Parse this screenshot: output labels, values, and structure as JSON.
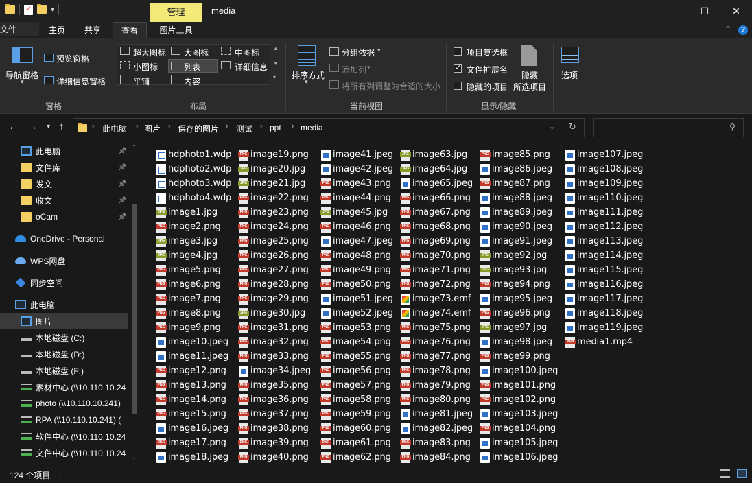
{
  "titlebar": {
    "contextual_tab": "管理",
    "title": "media",
    "minimize": "—",
    "maximize": "☐",
    "close": "✕"
  },
  "tabs": {
    "file": "文件",
    "home": "主页",
    "share": "共享",
    "view": "查看",
    "picture_tools": "图片工具"
  },
  "ribbon": {
    "panes": {
      "nav_pane": "导航窗格",
      "preview_pane": "预览窗格",
      "details_pane": "详细信息窗格",
      "group_label": "窗格"
    },
    "layout": {
      "extra_large": "超大图标",
      "large": "大图标",
      "medium": "中图标",
      "small": "小图标",
      "list": "列表",
      "details": "详细信息",
      "tiles": "平铺",
      "content": "内容",
      "group_label": "布局"
    },
    "current_view": {
      "sort_by": "排序方式",
      "group_by": "分组依据",
      "add_columns": "添加列",
      "size_all_columns": "将所有列调整为合适的大小",
      "group_label": "当前视图"
    },
    "show_hide": {
      "item_checkboxes": "项目复选框",
      "file_extensions": "文件扩展名",
      "hidden_items": "隐藏的项目",
      "hide_selected_1": "隐藏",
      "hide_selected_2": "所选项目",
      "group_label": "显示/隐藏",
      "item_checkboxes_checked": false,
      "file_extensions_checked": true,
      "hidden_items_checked": false
    },
    "options": "选项"
  },
  "address": {
    "breadcrumbs": [
      "此电脑",
      "图片",
      "保存的图片",
      "测试",
      "ppt",
      "media"
    ]
  },
  "nav": [
    {
      "label": "此电脑",
      "icon": "pc-icon",
      "pinned": true
    },
    {
      "label": "文件库",
      "icon": "folder-icon",
      "pinned": true
    },
    {
      "label": "发文",
      "icon": "folder-icon",
      "pinned": true
    },
    {
      "label": "收文",
      "icon": "folder-icon",
      "pinned": true
    },
    {
      "label": "oCam",
      "icon": "folder-icon",
      "pinned": true
    },
    {
      "label": "OneDrive - Personal",
      "icon": "onedrive-icon",
      "pinned": false
    },
    {
      "label": "WPS网盘",
      "icon": "wps-cloud-icon",
      "pinned": false
    },
    {
      "label": "同步空间",
      "icon": "sync-icon",
      "pinned": false
    },
    {
      "label": "此电脑",
      "icon": "pc-icon",
      "pinned": false
    },
    {
      "label": "图片",
      "icon": "pictures-icon",
      "pinned": false
    },
    {
      "label": "本地磁盘 (C:)",
      "icon": "drive-icon",
      "pinned": false
    },
    {
      "label": "本地磁盘 (D:)",
      "icon": "drive-icon",
      "pinned": false
    },
    {
      "label": "本地磁盘 (F:)",
      "icon": "drive-icon",
      "pinned": false
    },
    {
      "label": "素材中心 (\\\\10.110.10.24",
      "icon": "network-drive-icon",
      "pinned": false
    },
    {
      "label": "photo (\\\\10.110.10.241)",
      "icon": "network-drive-icon",
      "pinned": false
    },
    {
      "label": "RPA (\\\\10.110.10.241) (",
      "icon": "network-drive-icon",
      "pinned": false
    },
    {
      "label": "软件中心 (\\\\10.110.10.24",
      "icon": "network-drive-icon",
      "pinned": false
    },
    {
      "label": "文件中心 (\\\\10.110.10.24",
      "icon": "network-drive-icon",
      "pinned": false
    }
  ],
  "files": [
    [
      "hdphoto1.wdp",
      "hdphoto2.wdp",
      "hdphoto3.wdp",
      "hdphoto4.wdp",
      "image1.jpg",
      "image2.png",
      "image3.jpg",
      "image4.jpg",
      "image5.png",
      "image6.png",
      "image7.png",
      "image8.png",
      "image9.png",
      "image10.jpeg",
      "image11.jpeg",
      "image12.png",
      "image13.png",
      "image14.png",
      "image15.png",
      "image16.jpeg",
      "image17.png",
      "image18.jpeg"
    ],
    [
      "image19.png",
      "image20.jpg",
      "image21.jpg",
      "image22.png",
      "image23.png",
      "image24.png",
      "image25.png",
      "image26.png",
      "image27.png",
      "image28.png",
      "image29.png",
      "image30.jpg",
      "image31.png",
      "image32.png",
      "image33.png",
      "image34.jpeg",
      "image35.png",
      "image36.png",
      "image37.png",
      "image38.png",
      "image39.png",
      "image40.png"
    ],
    [
      "image41.jpeg",
      "image42.jpeg",
      "image43.png",
      "image44.png",
      "image45.jpg",
      "image46.png",
      "image47.jpeg",
      "image48.png",
      "image49.png",
      "image50.png",
      "image51.jpeg",
      "image52.jpeg",
      "image53.png",
      "image54.png",
      "image55.png",
      "image56.png",
      "image57.png",
      "image58.png",
      "image59.png",
      "image60.png",
      "image61.png",
      "image62.png"
    ],
    [
      "image63.jpg",
      "image64.jpg",
      "image65.jpeg",
      "image66.png",
      "image67.png",
      "image68.png",
      "image69.png",
      "image70.png",
      "image71.png",
      "image72.png",
      "image73.emf",
      "image74.emf",
      "image75.png",
      "image76.png",
      "image77.png",
      "image78.png",
      "image79.png",
      "image80.png",
      "image81.jpeg",
      "image82.jpeg",
      "image83.png",
      "image84.png"
    ],
    [
      "image85.png",
      "image86.jpeg",
      "image87.png",
      "image88.jpeg",
      "image89.jpeg",
      "image90.jpeg",
      "image91.jpeg",
      "image92.jpg",
      "image93.jpg",
      "image94.png",
      "image95.jpeg",
      "image96.png",
      "image97.jpg",
      "image98.jpeg",
      "image99.png",
      "image100.jpeg",
      "image101.png",
      "image102.png",
      "image103.jpeg",
      "image104.png",
      "image105.jpeg",
      "image106.jpeg"
    ],
    [
      "image107.jpeg",
      "image108.jpeg",
      "image109.jpeg",
      "image110.jpeg",
      "image111.jpeg",
      "image112.jpeg",
      "image113.jpeg",
      "image114.jpeg",
      "image115.jpeg",
      "image116.jpeg",
      "image117.jpeg",
      "image118.jpeg",
      "image119.jpeg",
      "media1.mp4"
    ]
  ],
  "status": {
    "item_count": "124 个项目"
  },
  "colors": {
    "background": "#191919",
    "ribbon": "#2b2b2b",
    "contextual_tab": "#f3e978",
    "selection": "#3a3a3a"
  }
}
